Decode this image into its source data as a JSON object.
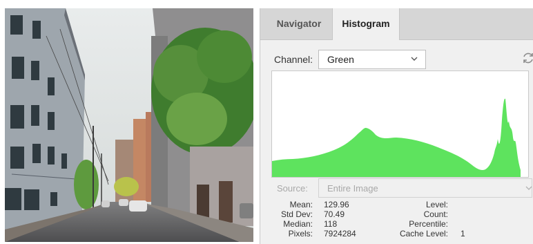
{
  "panel": {
    "tabs": [
      {
        "label": "Navigator",
        "active": false
      },
      {
        "label": "Histogram",
        "active": true
      }
    ],
    "channel": {
      "label": "Channel:",
      "value": "Green"
    },
    "source": {
      "label": "Source:",
      "value": "Entire Image",
      "disabled": true
    },
    "histogram_color": "#5ee35e",
    "stats_left": [
      {
        "label": "Mean:",
        "value": "129.96"
      },
      {
        "label": "Std Dev:",
        "value": "70.49"
      },
      {
        "label": "Median:",
        "value": "118"
      },
      {
        "label": "Pixels:",
        "value": "7924284"
      }
    ],
    "stats_right": [
      {
        "label": "Level:",
        "value": ""
      },
      {
        "label": "Count:",
        "value": ""
      },
      {
        "label": "Percentile:",
        "value": ""
      },
      {
        "label": "Cache Level:",
        "value": "1"
      }
    ],
    "icons": {
      "channel_dropdown": "chevron-down-icon",
      "source_dropdown": "chevron-down-icon",
      "refresh": "refresh-icon"
    }
  }
}
